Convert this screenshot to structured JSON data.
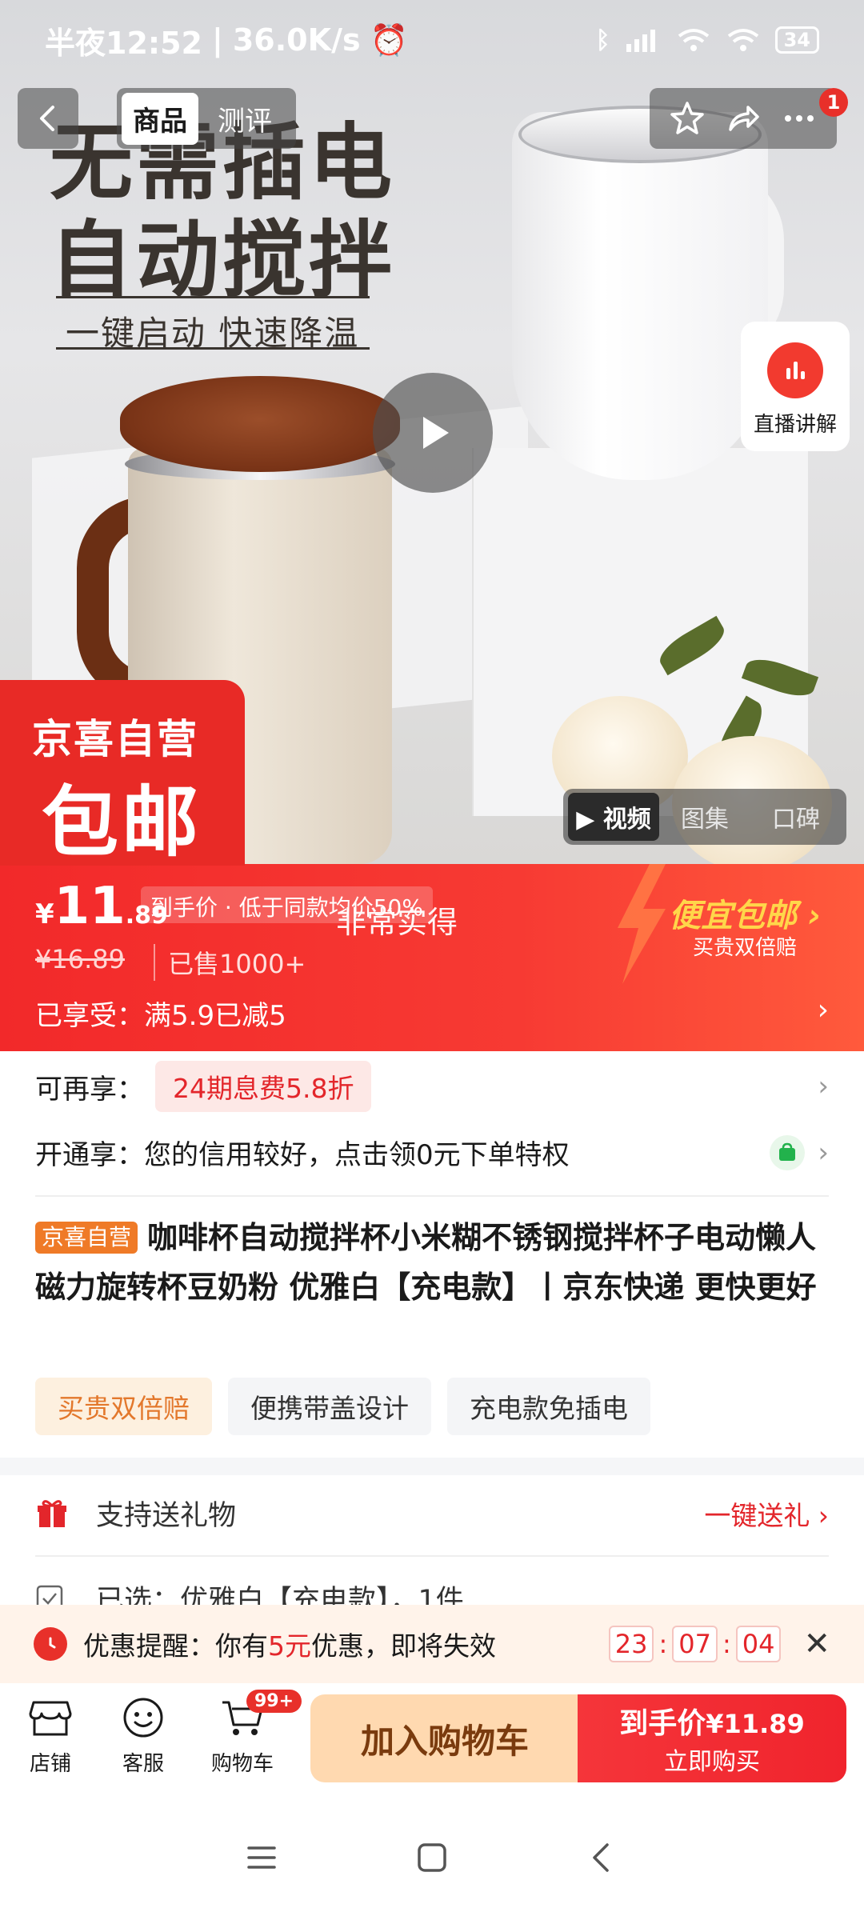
{
  "status_bar": {
    "time": "半夜12:52",
    "speed": "36.0K/s",
    "battery": "34"
  },
  "nav": {
    "tabs": [
      {
        "label": "商品"
      },
      {
        "label": "测评"
      }
    ],
    "badge_count": "1"
  },
  "hero": {
    "slogan_line1": "无需插电",
    "slogan_line2": "自动搅拌",
    "slogan_line3": "一键启动  快速降温",
    "live_label": "直播讲解",
    "jx_line1": "京喜自营",
    "jx_line2": "包邮",
    "media_tabs": [
      {
        "label": "视频"
      },
      {
        "label": "图集"
      },
      {
        "label": "口碑"
      }
    ]
  },
  "price": {
    "currency": "¥",
    "integer": "11",
    "decimal": ".89",
    "tag": "到手价 · 低于同款均价50%",
    "overlay_text": "非常实得",
    "original": "¥16.89",
    "sold": "已售1000+",
    "promo": "已享受：满5.9已减5",
    "cheap_title": "便宜包邮",
    "cheap_sub": "买贵双倍赔"
  },
  "benefits": {
    "more_label": "可再享：",
    "more_chip": "24期息费5.8折",
    "open_label": "开通享：",
    "open_text": "您的信用较好，点击领0元下单特权"
  },
  "product": {
    "title_tag": "京喜自营",
    "title": "咖啡杯自动搅拌杯小米糊不锈钢搅拌杯子电动懒人磁力旋转杯豆奶粉 优雅白【充电款】丨京东快递 更快更好",
    "tags": [
      {
        "label": "买贵双倍赔"
      },
      {
        "label": "便携带盖设计"
      },
      {
        "label": "充电款免插电"
      }
    ]
  },
  "gift": {
    "label": "支持送礼物",
    "action": "一键送礼"
  },
  "selected": {
    "text": "已选：优雅白【充电款】，1件"
  },
  "reminder": {
    "prefix": "优惠提醒：你有",
    "amount": "5元",
    "suffix": "优惠，即将失效",
    "hours": "23",
    "minutes": "07",
    "seconds": "04"
  },
  "bottom_bar": {
    "shop_label": "店铺",
    "service_label": "客服",
    "cart_label": "购物车",
    "cart_badge": "99+",
    "add_to_cart": "加入购物车",
    "buy_top": "到手价",
    "buy_price": "¥11.89",
    "buy_bottom": "立即购买"
  },
  "colors": {
    "accent": "#f2292a",
    "orange": "#ef7a27",
    "cart_button": "#ffd9b0"
  }
}
